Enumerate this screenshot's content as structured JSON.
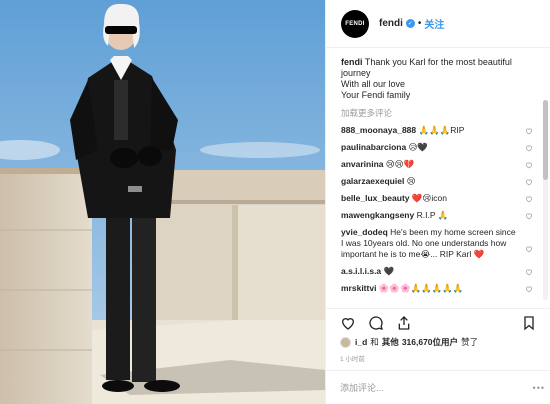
{
  "header": {
    "avatar_text": "FENDI",
    "username": "fendi",
    "separator": "•",
    "follow_label": "关注"
  },
  "caption": {
    "username": "fendi",
    "line1": "Thank you Karl for the most beautiful journey",
    "line2": "With all our love",
    "line3": "Your Fendi family"
  },
  "load_more_label": "加载更多评论",
  "comments": [
    {
      "user": "888_moonaya_888",
      "text": "🙏🙏🙏RIP"
    },
    {
      "user": "paulinabarciona",
      "text": "😥🖤"
    },
    {
      "user": "anvarinina",
      "text": "😢😢💔"
    },
    {
      "user": "galarzaexequiel",
      "text": "😢"
    },
    {
      "user": "belle_lux_beauty",
      "text": "❤️😢icon"
    },
    {
      "user": "mawengkangseny",
      "text": "R.I.P 🙏"
    },
    {
      "user": "yvie_dodeq",
      "text": "He's been my home screen since I was 10years old. No one understands how important he is to me😭... RIP Karl ❤️"
    },
    {
      "user": "a.s.i.l.i.s.a",
      "text": "🖤"
    },
    {
      "user": "mrskittvi",
      "text": "🌸🌸🌸🙏🙏🙏🙏🙏"
    }
  ],
  "likes": {
    "user": "i_d",
    "conj": "和",
    "others": "其他",
    "count": "316,670",
    "suffix": "位用户",
    "verb": "赞了"
  },
  "time_label": "1 小时前",
  "add_comment": {
    "placeholder": "添加评论..."
  },
  "more_label": "•••",
  "colors": {
    "accent": "#3897f0",
    "muted": "#999999",
    "text": "#262626",
    "sky": "#7fb1dd",
    "wall": "#d8cfc0"
  }
}
